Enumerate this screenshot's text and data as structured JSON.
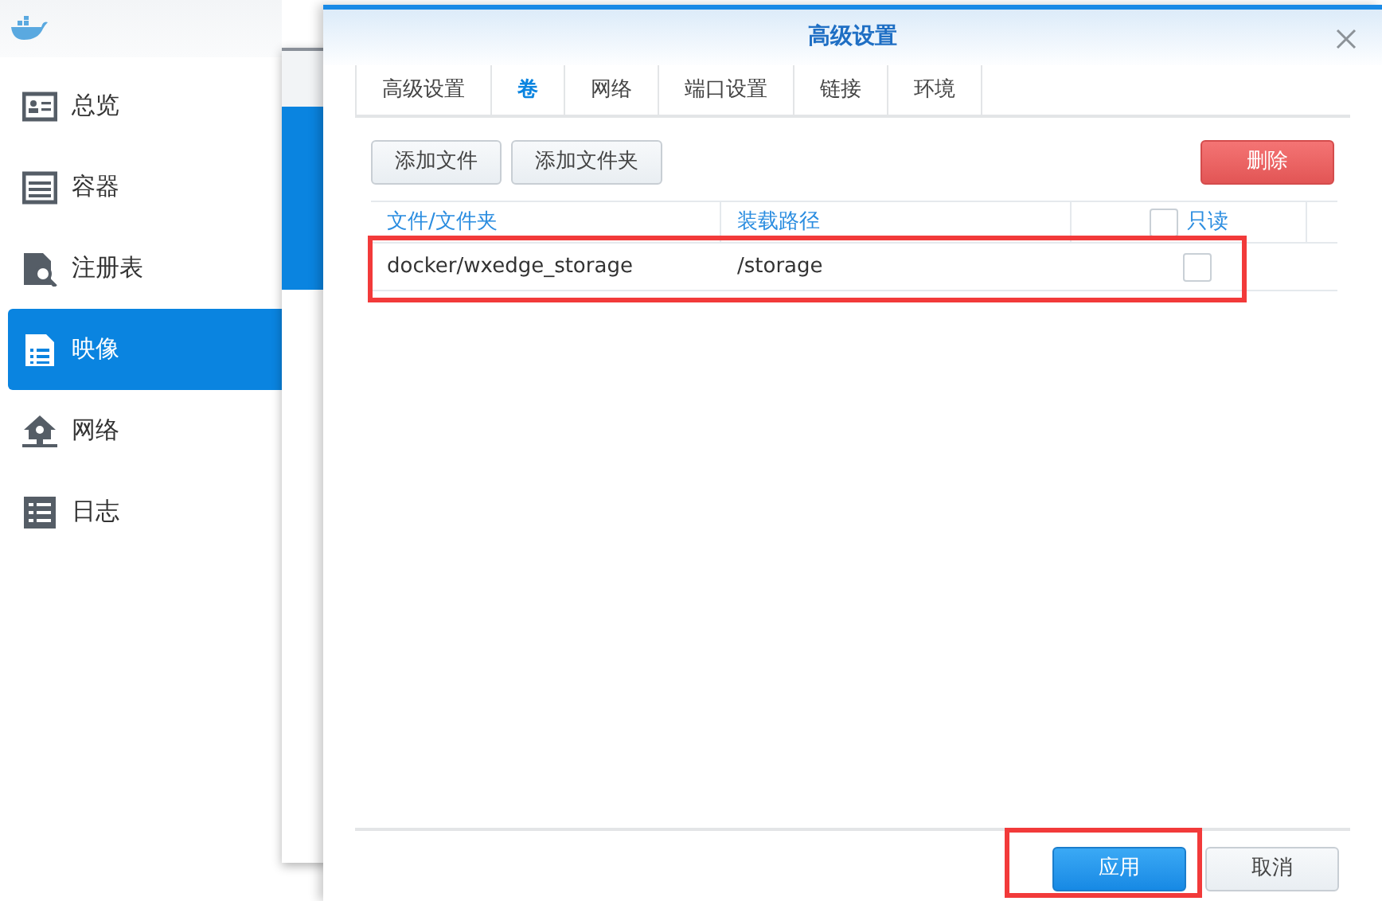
{
  "sidebar": {
    "items": [
      {
        "label": "总览",
        "selected": false
      },
      {
        "label": "容器",
        "selected": false
      },
      {
        "label": "注册表",
        "selected": false
      },
      {
        "label": "映像",
        "selected": true
      },
      {
        "label": "网络",
        "selected": false
      },
      {
        "label": "日志",
        "selected": false
      }
    ]
  },
  "dialog": {
    "title": "高级设置",
    "tabs": [
      {
        "label": "高级设置",
        "selected": false
      },
      {
        "label": "卷",
        "selected": true
      },
      {
        "label": "网络",
        "selected": false
      },
      {
        "label": "端口设置",
        "selected": false
      },
      {
        "label": "链接",
        "selected": false
      },
      {
        "label": "环境",
        "selected": false
      }
    ],
    "toolbar": {
      "buttons": [
        "添加文件",
        "添加文件夹"
      ],
      "delete_button": "删除"
    },
    "table": {
      "columns": [
        {
          "label": "文件/文件夹",
          "kind": "text"
        },
        {
          "label": "装载路径",
          "kind": "text"
        },
        {
          "label": "只读",
          "kind": "checkbox",
          "checked": false
        }
      ],
      "rows": [
        {
          "cells": [
            "docker/wxedge_storage",
            "/storage"
          ],
          "read_only": false,
          "highlighted": true
        }
      ]
    },
    "footer": {
      "apply_button": "应用",
      "cancel_button": "取消",
      "apply_highlighted": true
    }
  }
}
